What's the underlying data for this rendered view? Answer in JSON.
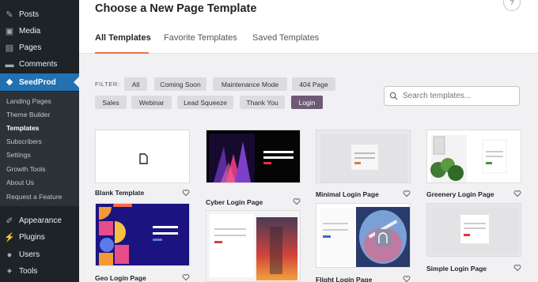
{
  "sidebar": {
    "items": [
      {
        "label": "Posts",
        "icon": "pin-icon"
      },
      {
        "label": "Media",
        "icon": "media-icon"
      },
      {
        "label": "Pages",
        "icon": "pages-icon"
      },
      {
        "label": "Comments",
        "icon": "comments-icon"
      },
      {
        "label": "SeedProd",
        "icon": "seedprod-icon"
      }
    ],
    "submenu": [
      "Landing Pages",
      "Theme Builder",
      "Templates",
      "Subscribers",
      "Settings",
      "Growth Tools",
      "About Us",
      "Request a Feature"
    ],
    "bottom_items": [
      {
        "label": "Appearance",
        "icon": "brush-icon"
      },
      {
        "label": "Plugins",
        "icon": "plugin-icon"
      },
      {
        "label": "Users",
        "icon": "users-icon"
      },
      {
        "label": "Tools",
        "icon": "wrench-icon"
      }
    ]
  },
  "header": {
    "title": "Choose a New Page Template",
    "tabs": [
      "All Templates",
      "Favorite Templates",
      "Saved Templates"
    ]
  },
  "filters": {
    "label": "FILTER:",
    "row1": [
      "All",
      "Coming Soon",
      "Maintenance Mode",
      "404 Page"
    ],
    "row2": [
      "Sales",
      "Webinar",
      "Lead Squeeze",
      "Thank You",
      "Login"
    ],
    "active": "Login"
  },
  "search": {
    "placeholder": "Search templates..."
  },
  "templates": [
    "Blank Template",
    "Cyber Login Page",
    "Minimal Login Page",
    "Greenery Login Page",
    "Geo Login Page",
    "",
    "Flight Login Page",
    "Simple Login Page"
  ],
  "colors": {
    "accent": "#e8734a",
    "wp_blue": "#2271b1",
    "active_chip": "#6d5a75"
  }
}
